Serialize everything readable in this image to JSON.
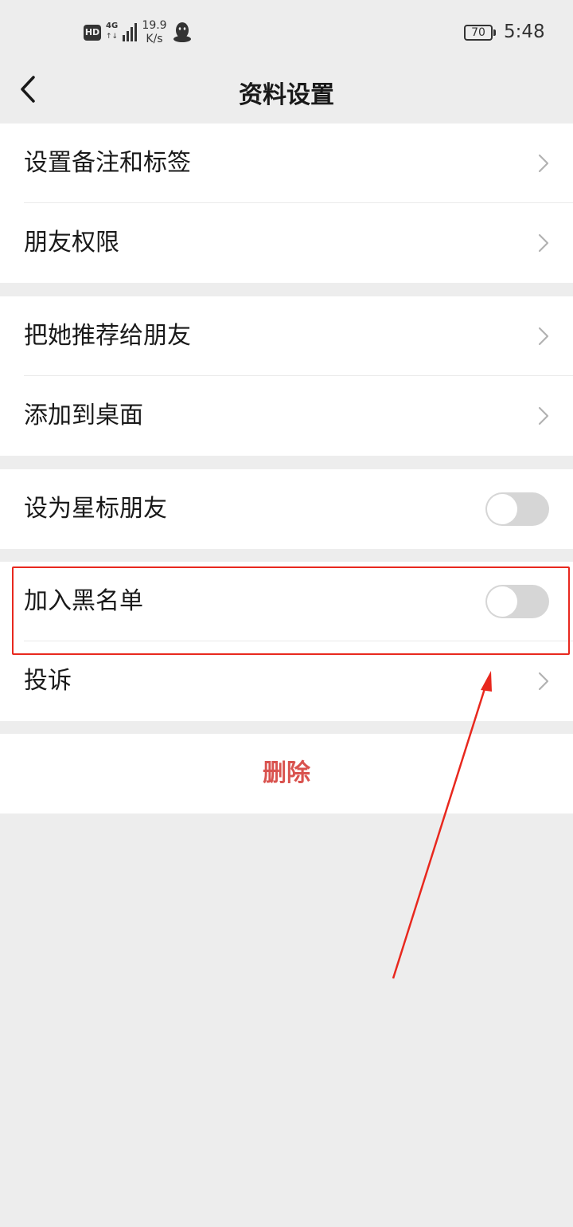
{
  "status_bar": {
    "hd_badge": "HD",
    "network": "4G",
    "network_arrows": "↑↓",
    "speed_value": "19.9",
    "speed_unit": "K/s",
    "battery": "70",
    "time": "5:48"
  },
  "nav": {
    "title": "资料设置"
  },
  "groups": [
    {
      "items": [
        {
          "label": "设置备注和标签",
          "control": "chevron"
        },
        {
          "label": "朋友权限",
          "control": "chevron"
        }
      ]
    },
    {
      "items": [
        {
          "label": "把她推荐给朋友",
          "control": "chevron"
        },
        {
          "label": "添加到桌面",
          "control": "chevron"
        }
      ]
    },
    {
      "items": [
        {
          "label": "设为星标朋友",
          "control": "toggle",
          "on": false
        }
      ]
    },
    {
      "items": [
        {
          "label": "加入黑名单",
          "control": "toggle",
          "on": false
        },
        {
          "label": "投诉",
          "control": "chevron"
        }
      ]
    }
  ],
  "delete_button": {
    "label": "删除",
    "color": "#d9534f"
  },
  "colors": {
    "background": "#ededed",
    "toggle_off": "#d6d6d6",
    "annotation": "#e8281e"
  }
}
